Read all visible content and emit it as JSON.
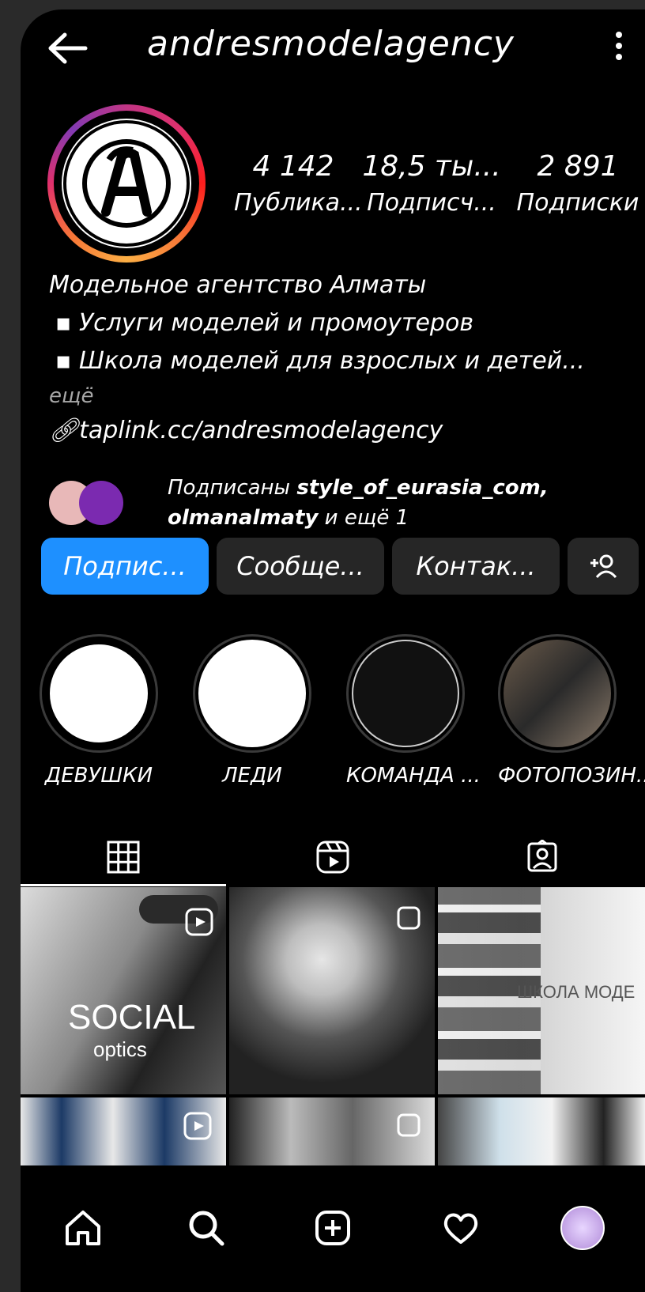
{
  "header": {
    "username": "andresmodelagency",
    "back_icon": "arrow-left-icon",
    "more_icon": "kebab-menu-icon"
  },
  "profile": {
    "avatar_ring_colors": [
      "#c13584",
      "#fcaf45",
      "#833ab4"
    ],
    "stats": [
      {
        "value": "4 142",
        "label": "Публика..."
      },
      {
        "value": "18,5 ты...",
        "label": "Подписч..."
      },
      {
        "value": "2 891",
        "label": "Подписки"
      }
    ]
  },
  "bio": {
    "lines": [
      "Модельное агентство Алматы",
      "▪ Услуги моделей и промоутеров",
      "▪ Школа моделей для взрослых и детей..."
    ],
    "more": "ещё",
    "link": "taplink.cc/andresmodelagency"
  },
  "followed_by": {
    "prefix": "Подписаны",
    "user1": "style_of_eurasia_com,",
    "user2": "olmanalmaty",
    "suffix": "и ещё 1"
  },
  "buttons": {
    "follow": "Подпис...",
    "message": "Сообще...",
    "contact": "Контак...",
    "add_person_icon": "add-person-icon",
    "follow_color": "#1e90ff"
  },
  "highlights": [
    {
      "label": "ДЕВУШКИ"
    },
    {
      "label": "ЛЕДИ"
    },
    {
      "label": "КОМАНДА ..."
    },
    {
      "label": "ФОТОПОЗИН..."
    }
  ],
  "tabs": [
    "grid-icon",
    "reels-icon",
    "tagged-icon"
  ],
  "posts": {
    "post1_title": "SOCIAL",
    "post1_sub": "optics",
    "post3_text": "ШКОЛА МОДЕ"
  },
  "nav": [
    "home-icon",
    "search-icon",
    "new-post-icon",
    "heart-icon",
    "profile-avatar-icon"
  ]
}
